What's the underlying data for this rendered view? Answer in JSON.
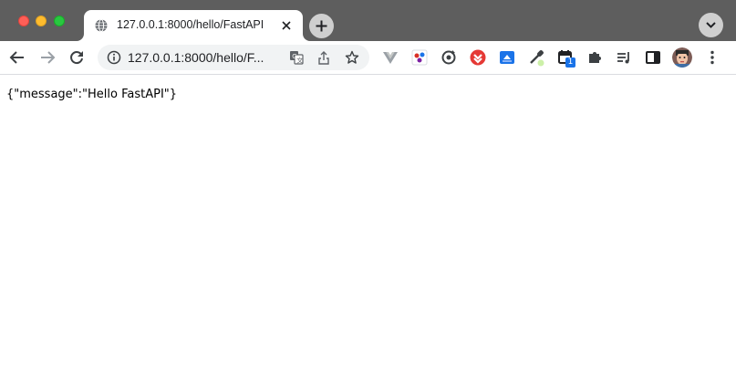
{
  "colors": {
    "tabstrip": "#5e5e5e",
    "toolbar": "#ffffff",
    "omnibox": "#f1f3f4",
    "accent": "#1a73e8"
  },
  "window": {
    "controls": [
      "close",
      "minimize",
      "maximize"
    ]
  },
  "tab": {
    "title": "127.0.0.1:8000/hello/FastAPI",
    "favicon": "globe-icon",
    "close_icon": "close-icon"
  },
  "toolbar": {
    "new_tab_icon": "plus-icon",
    "tab_search_icon": "chevron-down-icon",
    "back_icon": "arrow-left-icon",
    "forward_icon": "arrow-right-icon",
    "reload_icon": "reload-icon"
  },
  "omnibox": {
    "url": "127.0.0.1:8000/hello/F...",
    "site_info_icon": "info-icon",
    "translate_icon": "translate-icon",
    "share_icon": "share-icon",
    "bookmark_icon": "star-icon"
  },
  "extensions": [
    {
      "name": "vue-devtools-icon"
    },
    {
      "name": "ext-color-icon"
    },
    {
      "name": "ext-sync-icon"
    },
    {
      "name": "ext-red-circle-icon"
    },
    {
      "name": "ext-blue-square-icon"
    },
    {
      "name": "eyedropper-icon"
    },
    {
      "name": "calendar-icon",
      "badge": "1"
    },
    {
      "name": "puzzle-icon"
    },
    {
      "name": "reading-list-icon"
    },
    {
      "name": "side-panel-icon"
    }
  ],
  "profile": {
    "avatar_icon": "avatar-icon",
    "menu_icon": "kebab-menu-icon"
  },
  "page": {
    "body_text": "{\"message\":\"Hello FastAPI\"}"
  }
}
